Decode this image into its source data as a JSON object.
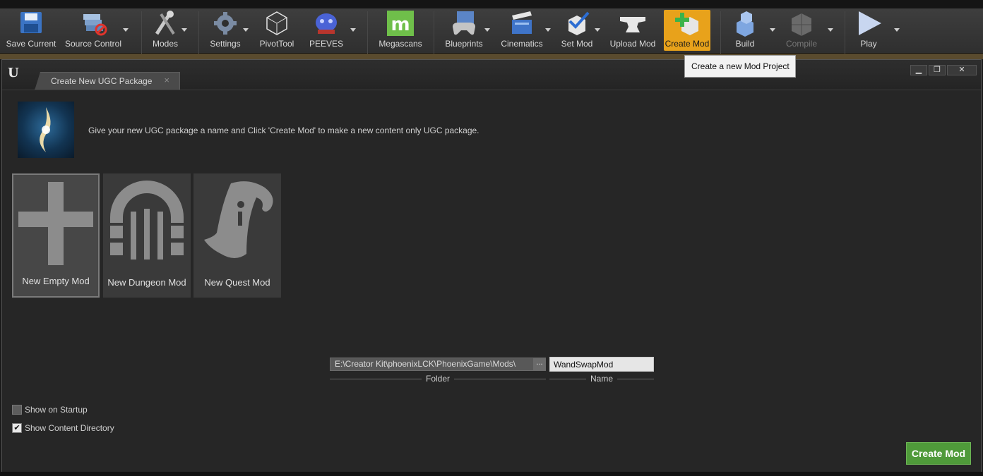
{
  "toolbar": {
    "save_current": "Save Current",
    "source_control": "Source Control",
    "modes": "Modes",
    "settings": "Settings",
    "pivot_tool": "PivotTool",
    "peeves": "PEEVES",
    "megascans": "Megascans",
    "blueprints": "Blueprints",
    "cinematics": "Cinematics",
    "set_mod": "Set Mod",
    "upload_mod": "Upload Mod",
    "create_mod": "Create Mod",
    "build": "Build",
    "compile": "Compile",
    "play": "Play",
    "accent_color": "#e8a21b"
  },
  "tooltip": {
    "text": "Create a new Mod Project"
  },
  "window": {
    "tab_title": "Create New UGC Package",
    "tab_close": "×",
    "minimize": "▁",
    "maximize": "❐",
    "close": "✕"
  },
  "content": {
    "intro_text": "Give your new UGC package a name and Click 'Create Mod' to make a new content only UGC package.",
    "templates": [
      {
        "label": "New Empty Mod",
        "selected": true
      },
      {
        "label": "New Dungeon Mod",
        "selected": false
      },
      {
        "label": "New Quest Mod",
        "selected": false
      }
    ],
    "folder_value": "E:\\Creator Kit\\phoenixLCK\\PhoenixGame\\Mods\\",
    "folder_browse": "...",
    "folder_caption": "Folder",
    "name_value": "WandSwapMod",
    "name_caption": "Name",
    "show_on_startup": {
      "label": "Show on Startup",
      "checked": false
    },
    "show_content_directory": {
      "label": "Show Content Directory",
      "checked": true
    },
    "create_button": "Create Mod",
    "create_button_color": "#4f9a3a"
  }
}
